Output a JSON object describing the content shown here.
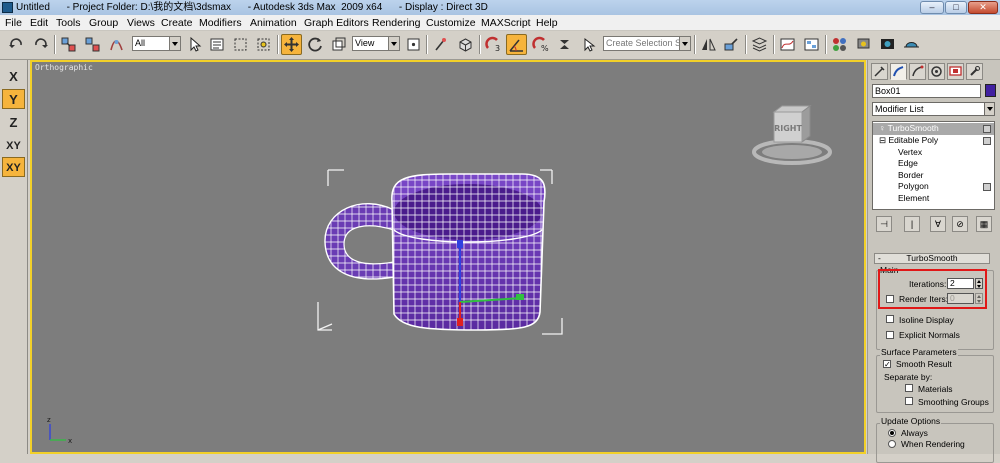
{
  "window": {
    "title": "Untitled      - Project Folder: D:\\我的文档\\3dsmax      - Autodesk 3ds Max  2009 x64      - Display : Direct 3D",
    "minimize": "–",
    "maximize": "□",
    "close": "✕"
  },
  "menu": [
    "File",
    "Edit",
    "Tools",
    "Group",
    "Views",
    "Create",
    "Modifiers",
    "Animation",
    "Graph Editors",
    "Rendering",
    "Customize",
    "MAXScript",
    "Help"
  ],
  "toolbar": {
    "selection_filter": "All",
    "ref_coord": "View",
    "named_selection_placeholder": "Create Selection Set"
  },
  "axis_constraints": [
    {
      "label": "X",
      "active": false
    },
    {
      "label": "Y",
      "active": true
    },
    {
      "label": "Z",
      "active": false
    },
    {
      "label": "XY",
      "active": false
    },
    {
      "label": "XY",
      "active": true
    }
  ],
  "viewport": {
    "label": "Orthographic",
    "viewcube_face": "RIGHT",
    "gizmo": {
      "z": "z",
      "x": "x"
    }
  },
  "command_panel": {
    "object_name": "Box01",
    "object_color": "#4020a0",
    "modifier_list": "Modifier List",
    "stack": [
      {
        "label": "TurboSmooth",
        "selected": true
      },
      {
        "label": "Editable Poly",
        "selected": false
      },
      {
        "label": "Vertex"
      },
      {
        "label": "Edge"
      },
      {
        "label": "Border"
      },
      {
        "label": "Polygon"
      },
      {
        "label": "Element"
      }
    ],
    "rollout_title": "TurboSmooth",
    "rollout_toggle": "-",
    "main": {
      "group": "Main",
      "iterations_label": "Iterations:",
      "iterations_value": "2",
      "render_iters_label": "Render Iters:",
      "render_iters_value": "0",
      "isoline_label": "Isoline Display",
      "explicit_normals_label": "Explicit Normals"
    },
    "surface": {
      "group": "Surface Parameters",
      "smooth_result_label": "Smooth Result",
      "smooth_result_checked": "✓",
      "separate_by": "Separate by:",
      "materials": "Materials",
      "smoothing_groups": "Smoothing Groups"
    },
    "update": {
      "group": "Update Options",
      "always": "Always",
      "when_rendering": "When Rendering"
    }
  },
  "highlight_color": "#e01818"
}
